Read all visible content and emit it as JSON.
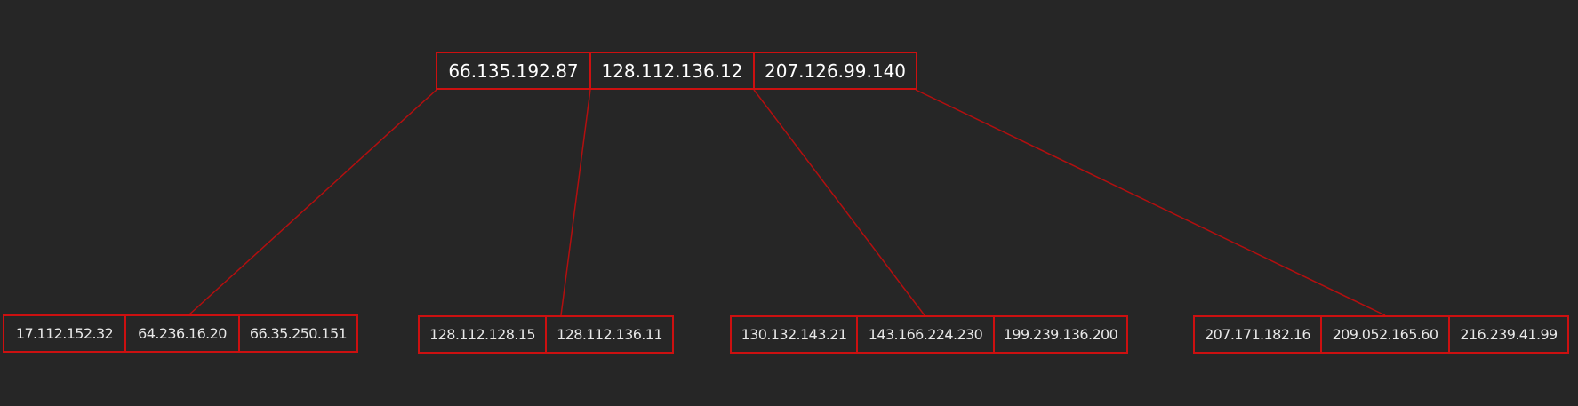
{
  "colors": {
    "background": "#262626",
    "border": "#cc1010",
    "edge": "#b30f0f",
    "text": "#ffffff"
  },
  "root": {
    "keys": [
      "66.135.192.87",
      "128.112.136.12",
      "207.126.99.140"
    ]
  },
  "leaves": [
    {
      "keys": [
        "17.112.152.32",
        "64.236.16.20",
        "66.35.250.151"
      ]
    },
    {
      "keys": [
        "128.112.128.15",
        "128.112.136.11"
      ]
    },
    {
      "keys": [
        "130.132.143.21",
        "143.166.224.230",
        "199.239.136.200"
      ]
    },
    {
      "keys": [
        "207.171.182.16",
        "209.052.165.60",
        "216.239.41.99"
      ]
    }
  ]
}
